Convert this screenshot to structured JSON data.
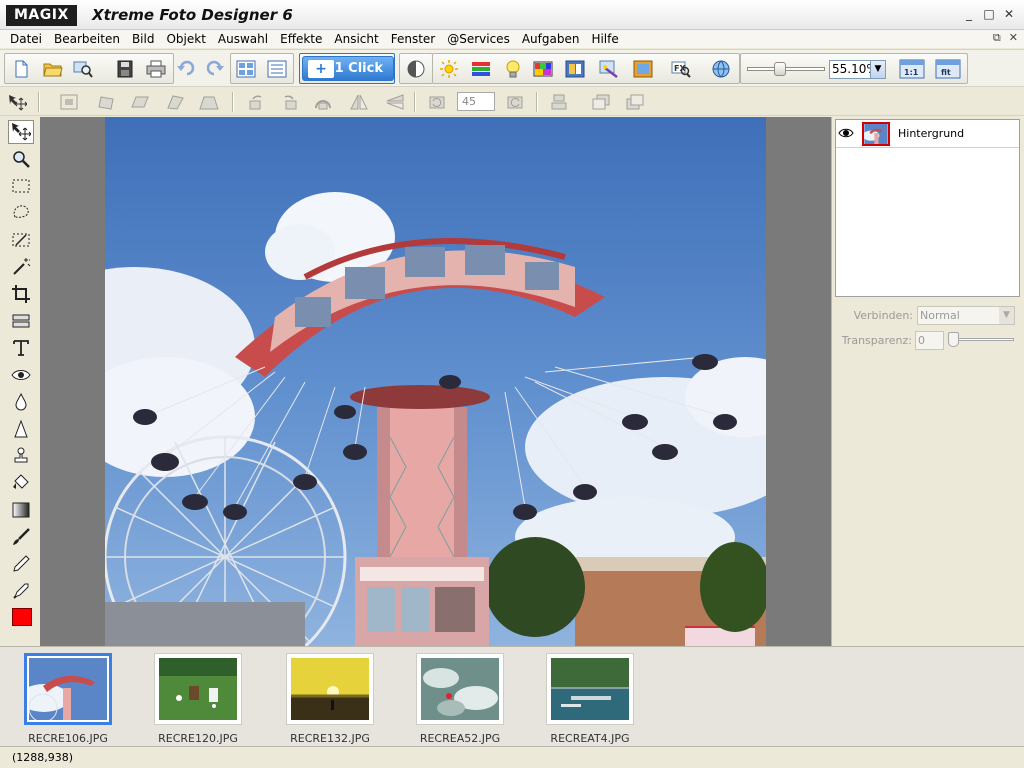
{
  "window": {
    "brand": "MAGIX",
    "title": "Xtreme Foto Designer 6",
    "controls": [
      "_",
      "□",
      "✕"
    ]
  },
  "menu": {
    "items": [
      "Datei",
      "Bearbeiten",
      "Bild",
      "Objekt",
      "Auswahl",
      "Effekte",
      "Ansicht",
      "Fenster",
      "@Services",
      "Aufgaben",
      "Hilfe"
    ],
    "doc_controls": [
      "⧉",
      "✕"
    ]
  },
  "toolbar": {
    "one_click_label": "1 Click",
    "one_click_badge": "+",
    "zoom_value": "55.10%",
    "zoom_dropdown_icon": "▼",
    "zoom_1to1_label": "1:1",
    "zoom_fit_label": "fit"
  },
  "transform_toolbar": {
    "angle_value": "45"
  },
  "tools": [
    "move-select-tool",
    "zoom-tool",
    "rect-select-tool",
    "lasso-tool",
    "magic-select-tool",
    "magic-wand-tool",
    "crop-tool",
    "straighten-tool",
    "text-tool",
    "red-eye-tool",
    "blur-tool",
    "sharpen-tool",
    "clone-stamp-tool",
    "fill-tool",
    "gradient-tool",
    "brush-tool",
    "pencil-tool",
    "eyedropper-tool"
  ],
  "foreground_color": "#ff0000",
  "layers": {
    "list": [
      {
        "name": "Hintergrund",
        "visible": true,
        "selected": true
      }
    ],
    "blend_label": "Verbinden:",
    "blend_value": "Normal",
    "blend_dropdown_icon": "▼",
    "transparency_label": "Transparenz:",
    "transparency_value": "0"
  },
  "thumbnails": [
    {
      "file": "RECRE106.JPG",
      "selected": true
    },
    {
      "file": "RECRE120.JPG",
      "selected": false
    },
    {
      "file": "RECRE132.JPG",
      "selected": false
    },
    {
      "file": "RECREA52.JPG",
      "selected": false
    },
    {
      "file": "RECREAT4.JPG",
      "selected": false
    }
  ],
  "status": {
    "coords": "(1288,938)"
  }
}
